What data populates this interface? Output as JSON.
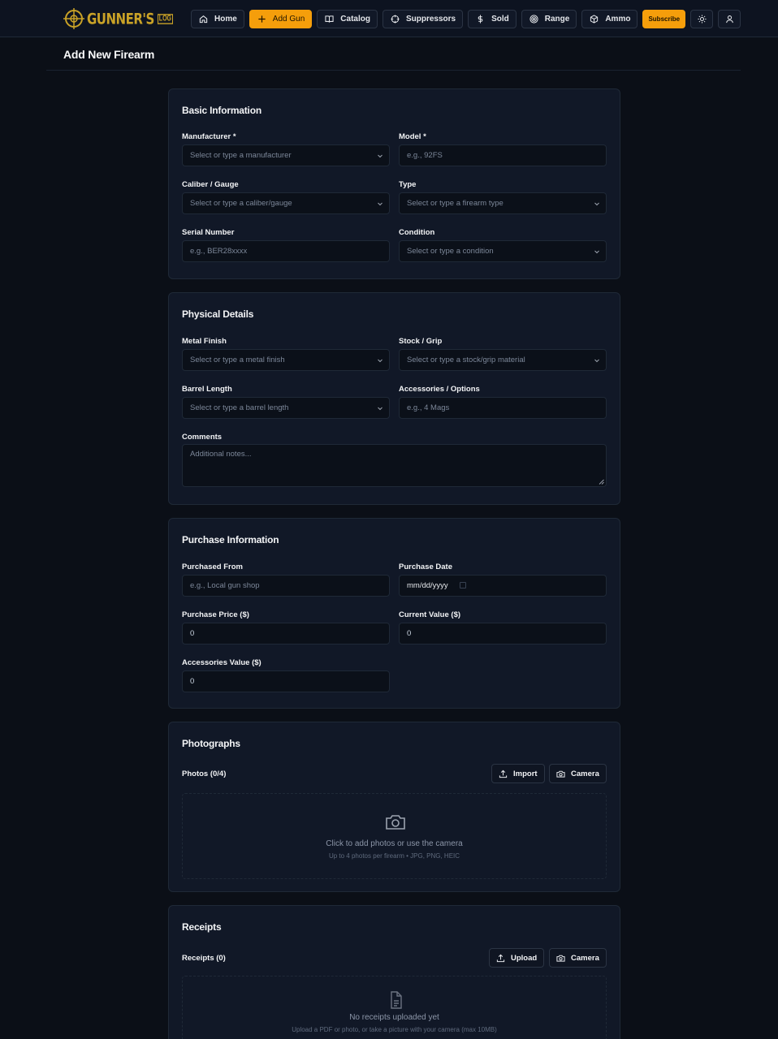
{
  "nav": {
    "logo_text": "GUNNER'S",
    "logo_sub": "LOG",
    "items": [
      {
        "label": "Home",
        "icon": "home-icon"
      },
      {
        "label": "Add Gun",
        "icon": "plus-icon"
      },
      {
        "label": "Catalog",
        "icon": "book-icon"
      },
      {
        "label": "Suppressors",
        "icon": "crosshair-icon"
      },
      {
        "label": "Sold",
        "icon": "dollar-icon"
      },
      {
        "label": "Range",
        "icon": "target-icon"
      },
      {
        "label": "Ammo",
        "icon": "box-icon"
      }
    ],
    "subscribe_label": "Subscribe",
    "accent": "#f59e0b"
  },
  "page": {
    "title": "Add New Firearm"
  },
  "basic": {
    "title": "Basic Information",
    "manufacturer": {
      "label": "Manufacturer *",
      "placeholder": "Select or type a manufacturer"
    },
    "model": {
      "label": "Model *",
      "placeholder": "e.g., 92FS"
    },
    "caliber": {
      "label": "Caliber / Gauge",
      "placeholder": "Select or type a caliber/gauge"
    },
    "type": {
      "label": "Type",
      "placeholder": "Select or type a firearm type"
    },
    "serial": {
      "label": "Serial Number",
      "placeholder": "e.g., BER28xxxx"
    },
    "condition": {
      "label": "Condition",
      "placeholder": "Select or type a condition"
    }
  },
  "physical": {
    "title": "Physical Details",
    "finish": {
      "label": "Metal Finish",
      "placeholder": "Select or type a metal finish"
    },
    "stock": {
      "label": "Stock / Grip",
      "placeholder": "Select or type a stock/grip material"
    },
    "barrel": {
      "label": "Barrel Length",
      "placeholder": "Select or type a barrel length"
    },
    "accessories": {
      "label": "Accessories / Options",
      "placeholder": "e.g., 4 Mags"
    },
    "comments": {
      "label": "Comments",
      "placeholder": "Additional notes..."
    }
  },
  "purchase": {
    "title": "Purchase Information",
    "from": {
      "label": "Purchased From",
      "placeholder": "e.g., Local gun shop"
    },
    "date": {
      "label": "Purchase Date",
      "value": "mm/dd/yyyy"
    },
    "price": {
      "label": "Purchase Price ($)",
      "value": "0"
    },
    "current": {
      "label": "Current Value ($)",
      "value": "0"
    },
    "acc_value": {
      "label": "Accessories Value ($)",
      "value": "0"
    }
  },
  "photos": {
    "title": "Photographs",
    "count_label": "Photos (0/4)",
    "import_label": "Import",
    "camera_label": "Camera",
    "empty_main": "Click to add photos or use the camera",
    "empty_sub": "Up to 4 photos per firearm • JPG, PNG, HEIC"
  },
  "receipts": {
    "title": "Receipts",
    "count_label": "Receipts (0)",
    "upload_label": "Upload",
    "camera_label": "Camera",
    "empty_main": "No receipts uploaded yet",
    "empty_sub": "Upload a PDF or photo, or take a picture with your camera (max 10MB)"
  }
}
